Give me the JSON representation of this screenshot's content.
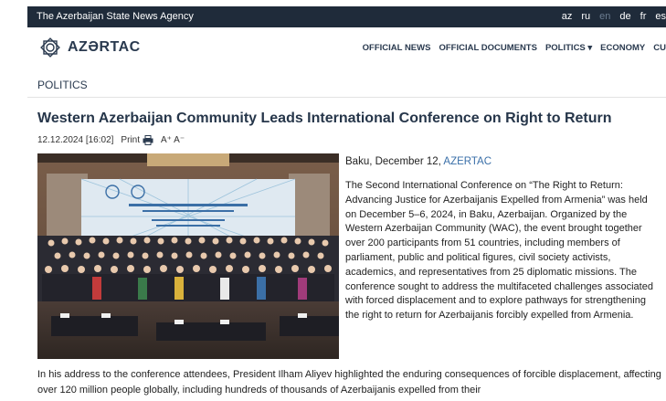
{
  "topbar": {
    "agency": "The Azerbaijan State News Agency",
    "languages": [
      "az",
      "ru",
      "en",
      "de",
      "fr",
      "es"
    ],
    "active_language": "en"
  },
  "header": {
    "logo_text": "AZƏRTAC",
    "nav": [
      "OFFICIAL NEWS",
      "OFFICIAL DOCUMENTS",
      "POLITICS ▾",
      "ECONOMY",
      "CU"
    ]
  },
  "section": "POLITICS",
  "article": {
    "title": "Western Azerbaijan Community Leads International Conference on Right to Return",
    "date": "12.12.2024 [16:02]",
    "print_label": "Print",
    "font_controls": "A⁺ A⁻",
    "dateline": "Baku, December 12, ",
    "source": "AZERTAC",
    "paragraph1": "The Second International Conference on “The Right to Return: Advancing Justice for Azerbaijanis Expelled from Armenia” was held on December 5–6, 2024, in Baku, Azerbaijan. Organized by the Western Azerbaijan Community (WAC), the event brought together over 200 participants from 51 countries, including members of parliament, public and political figures, civil society activists, academics, and representatives from 25 diplomatic missions. The conference sought to address the multifaceted challenges associated with forced displacement and to explore pathways for strengthening the right to return for Azerbaijanis forcibly expelled from Armenia.",
    "paragraph2": "In his address to the conference attendees, President Ilham Aliyev highlighted the enduring consequences of forcible displacement, affecting over 120 million people globally, including hundreds of thousands of Azerbaijanis expelled from their"
  },
  "colors": {
    "topbar": "#1f2b3a",
    "brand": "#2a3a4f",
    "link": "#3a6fa8"
  }
}
